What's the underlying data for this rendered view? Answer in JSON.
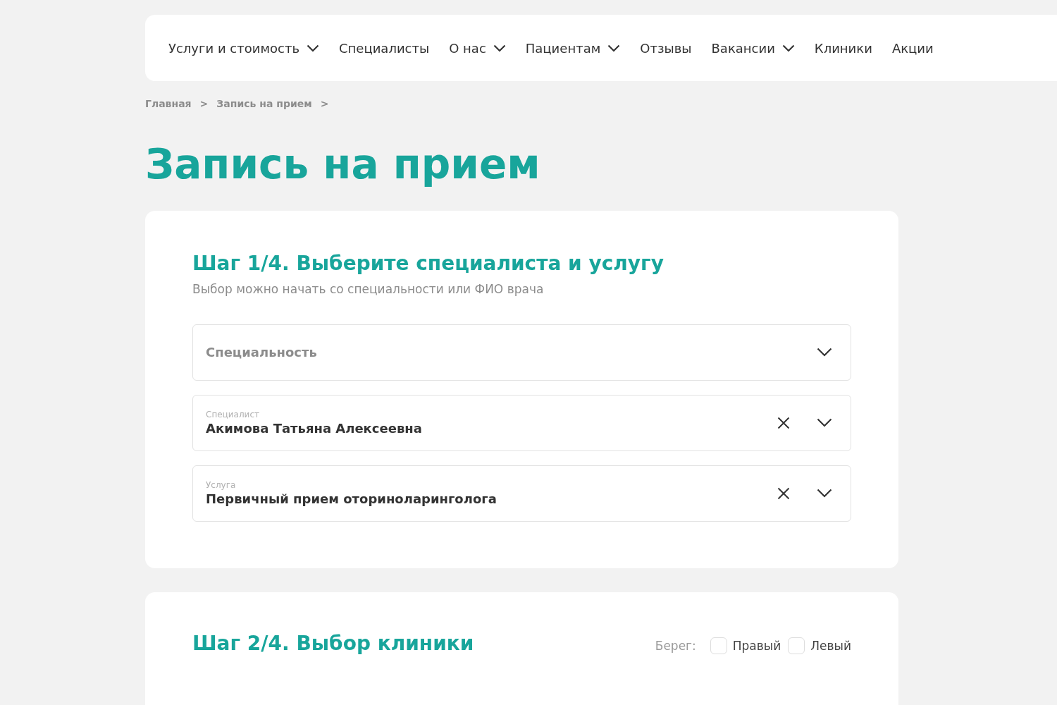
{
  "nav": {
    "items": [
      {
        "label": "Услуги и стоимость",
        "dropdown": true
      },
      {
        "label": "Специалисты",
        "dropdown": false
      },
      {
        "label": "О нас",
        "dropdown": true
      },
      {
        "label": "Пациентам",
        "dropdown": true
      },
      {
        "label": "Отзывы",
        "dropdown": false
      },
      {
        "label": "Вакансии",
        "dropdown": true
      },
      {
        "label": "Клиники",
        "dropdown": false
      },
      {
        "label": "Акции",
        "dropdown": false
      }
    ]
  },
  "breadcrumbs": [
    {
      "label": "Главная",
      "separator": ">"
    },
    {
      "label": "Запись на прием",
      "separator": ">"
    }
  ],
  "page_title": "Запись на прием",
  "step1": {
    "title": "Шаг 1/4. Выберите специалиста и услугу",
    "subtitle": "Выбор можно начать со специальности или ФИО врача",
    "fields": [
      {
        "kind": "empty",
        "placeholder": "Специальность"
      },
      {
        "kind": "filled",
        "label": "Специалист",
        "value": "Акимова Татьяна Алексеевна"
      },
      {
        "kind": "filled",
        "label": "Услуга",
        "value": "Первичный прием оториноларинголога"
      }
    ]
  },
  "step2": {
    "title": "Шаг 2/4. Выбор клиники",
    "filter_label": "Берег:",
    "options": [
      {
        "label": "Правый",
        "checked": false
      },
      {
        "label": "Левый",
        "checked": false
      }
    ]
  }
}
